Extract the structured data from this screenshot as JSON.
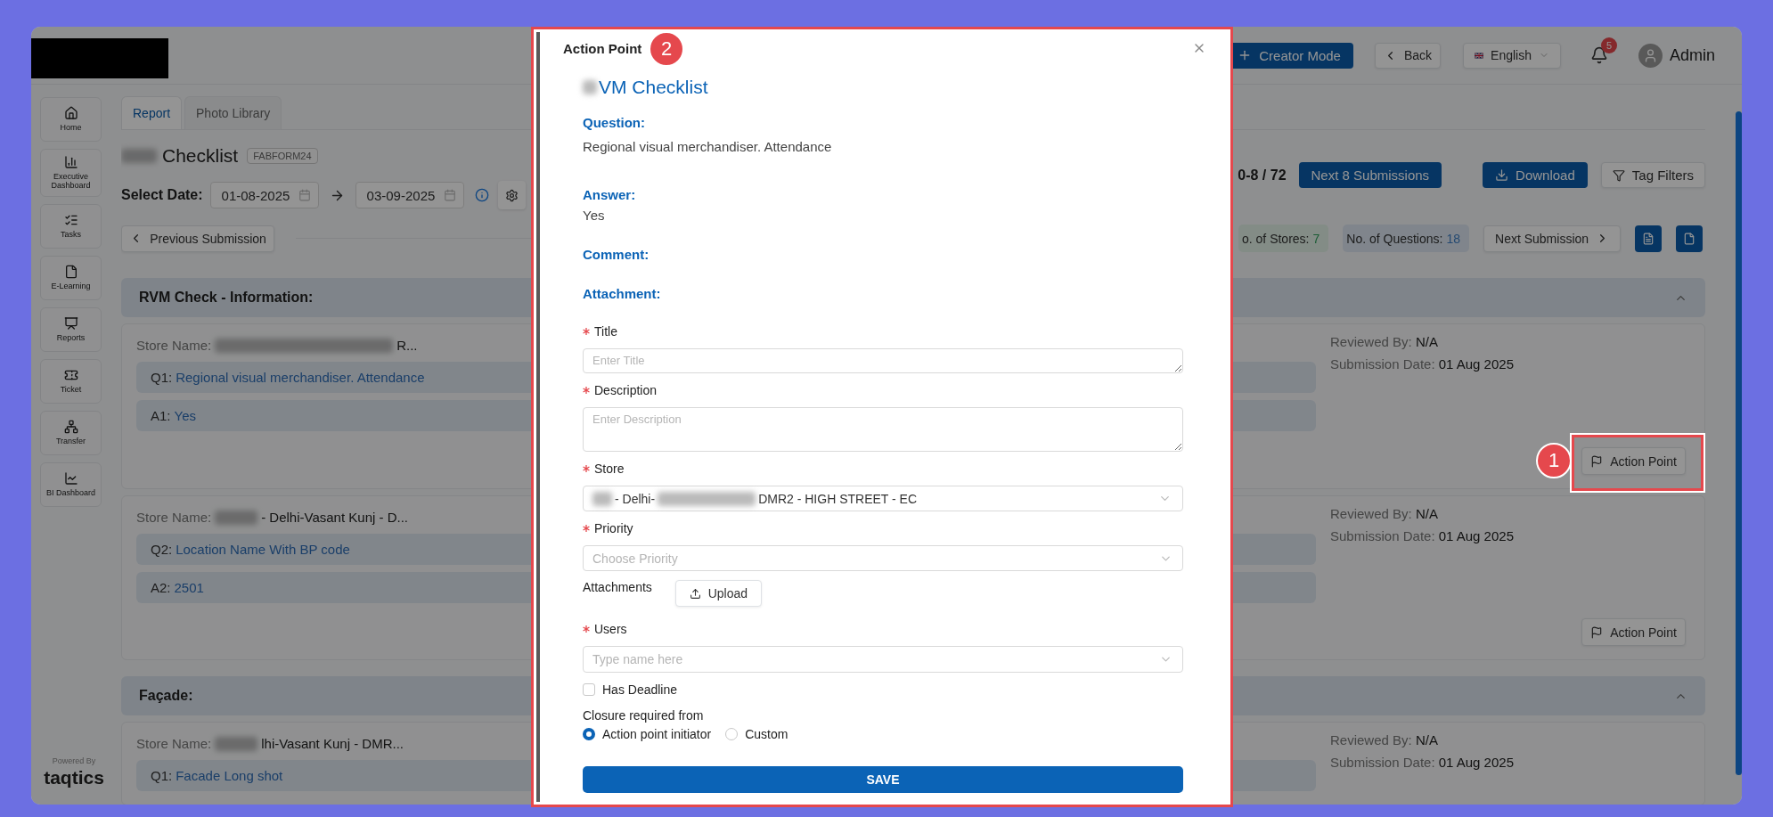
{
  "header": {
    "creator_button": "Creator Mode",
    "back_button": "Back",
    "language": "English",
    "notifications": "5",
    "user": "Admin"
  },
  "sidebar": {
    "items": [
      {
        "label": "Home"
      },
      {
        "label": "Executive Dashboard"
      },
      {
        "label": "Tasks"
      },
      {
        "label": "E-Learning"
      },
      {
        "label": "Reports"
      },
      {
        "label": "Ticket"
      },
      {
        "label": "Transfer"
      },
      {
        "label": "BI Dashboard"
      }
    ],
    "powered_by": "Powered By",
    "brand": "taqtics"
  },
  "tabs": [
    {
      "label": "Report",
      "selected": true
    },
    {
      "label": "Photo Library",
      "selected": false
    }
  ],
  "checklist": {
    "title": "Checklist",
    "code": "FABFORM24"
  },
  "date_filter": {
    "label": "Select Date:",
    "from": "01-08-2025",
    "to": "03-09-2025"
  },
  "pagination": {
    "range": "0-8 / 72",
    "next_button": "Next 8 Submissions"
  },
  "download_button": "Download",
  "tag_filters_button": "Tag Filters",
  "previous_button": "Previous Submission",
  "stats": [
    {
      "kind": "stores",
      "label": "o. of Stores:",
      "value": "7"
    },
    {
      "kind": "questions",
      "label": "No. of Questions:",
      "value": "18"
    }
  ],
  "next_submission_button": "Next Submission",
  "sections": [
    {
      "title": "RVM Check - Information:",
      "expanded": true,
      "cards": [
        {
          "store_label": "Store Name:",
          "store_value": "R...",
          "qa": [
            {
              "prefix": "Q1:",
              "text": "Regional visual merchandiser. Attendance"
            },
            {
              "prefix": "A1:",
              "text": "Yes"
            }
          ],
          "reviewed_label": "Reviewed By:",
          "reviewed_value": "N/A",
          "date_label": "Submission Date:",
          "date_value": "01 Aug 2025",
          "action_button": "Action Point"
        },
        {
          "store_label": "Store Name:",
          "store_value": "- Delhi-Vasant Kunj - D...",
          "qa": [
            {
              "prefix": "Q2:",
              "text": "Location Name With BP code"
            },
            {
              "prefix": "A2:",
              "text": "2501"
            }
          ],
          "reviewed_label": "Reviewed By:",
          "reviewed_value": "N/A",
          "date_label": "Submission Date:",
          "date_value": "01 Aug 2025",
          "action_button": "Action Point"
        }
      ]
    },
    {
      "title": "Façade:",
      "expanded": true,
      "cards": [
        {
          "store_label": "Store Name:",
          "store_value": "lhi-Vasant Kunj - DMR...",
          "qa": [
            {
              "prefix": "Q1:",
              "text": "Facade Long shot"
            }
          ],
          "reviewed_label": "Reviewed By:",
          "reviewed_value": "N/A",
          "date_label": "Submission Date:",
          "date_value": "01 Aug 2025"
        }
      ]
    }
  ],
  "modal": {
    "title": "Action Point",
    "checklist": "VM Checklist",
    "question_label": "Question:",
    "question": "Regional visual merchandiser. Attendance",
    "answer_label": "Answer:",
    "answer": "Yes",
    "comment_label": "Comment:",
    "attachment_label": "Attachment:",
    "fields": [
      {
        "kind": "input",
        "label": "Title",
        "required": true,
        "placeholder": "Enter Title"
      },
      {
        "kind": "textarea",
        "label": "Description",
        "required": true,
        "placeholder": "Enter Description"
      },
      {
        "kind": "select",
        "label": "Store",
        "required": true,
        "value": "- Delhi-",
        "value_end": "DMR2 - HIGH STREET - EC"
      },
      {
        "kind": "select",
        "label": "Priority",
        "required": true,
        "placeholder": "Choose Priority"
      },
      {
        "kind": "upload",
        "label": "Attachments",
        "button": "Upload"
      },
      {
        "kind": "select",
        "label": "Users",
        "required": true,
        "placeholder": "Type name here"
      },
      {
        "kind": "checkbox",
        "label": "Has Deadline",
        "checked": false
      },
      {
        "kind": "radio",
        "label": "Closure required from",
        "options": [
          {
            "label": "Action point initiator",
            "selected": true
          },
          {
            "label": "Custom",
            "selected": false
          }
        ]
      }
    ],
    "save_button": "SAVE"
  },
  "annotations": [
    {
      "number": "1"
    },
    {
      "number": "2"
    }
  ]
}
